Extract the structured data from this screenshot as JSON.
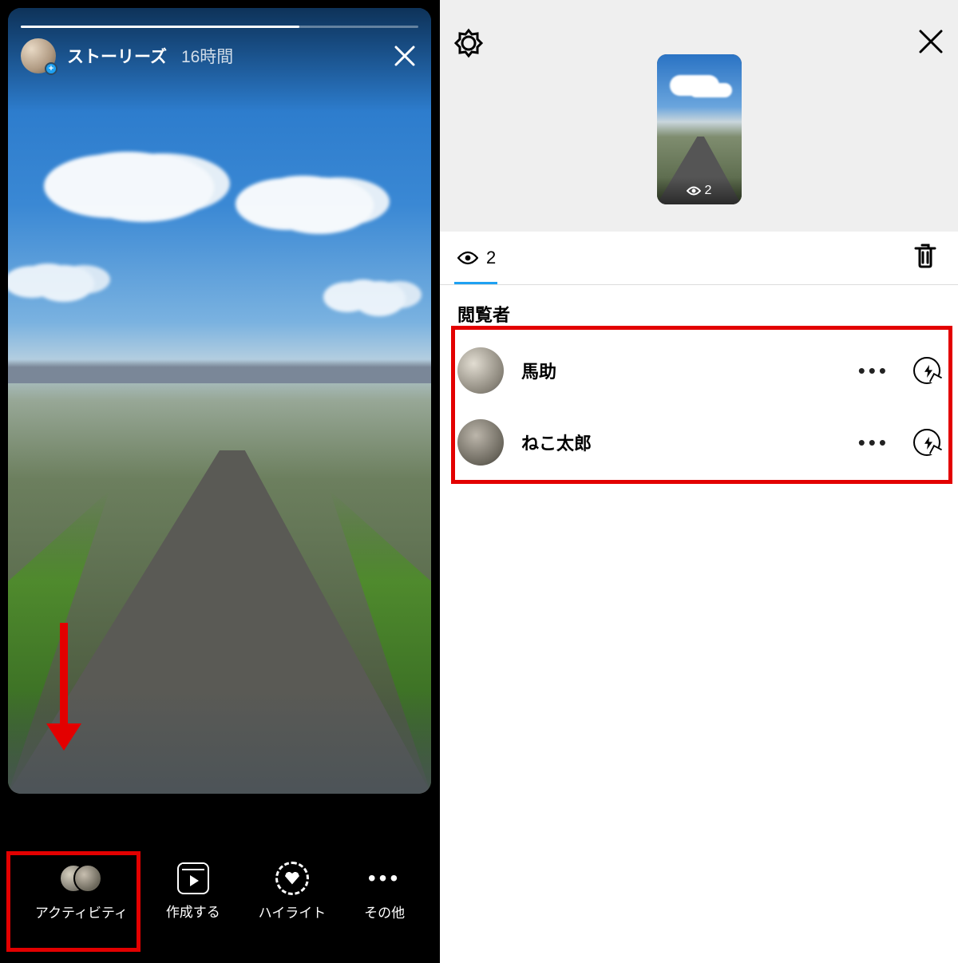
{
  "left": {
    "title": "ストーリーズ",
    "time": "16時間",
    "avatar_plus": "+",
    "bottombar": {
      "activity": "アクティビティ",
      "create": "作成する",
      "highlight": "ハイライト",
      "more_label": "その他",
      "more_dots": "•••"
    }
  },
  "right": {
    "thumb_views": "2",
    "count": "2",
    "section_title": "閲覧者",
    "viewers": [
      {
        "name": "馬助"
      },
      {
        "name": "ねこ太郎"
      }
    ],
    "row_dots": "•••"
  }
}
